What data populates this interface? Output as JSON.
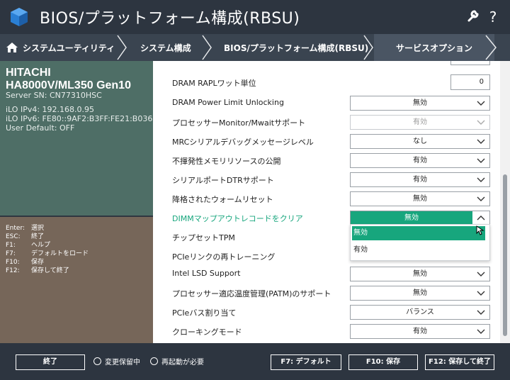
{
  "header": {
    "title": "BIOS/プラットフォーム構成(RBSU)",
    "icons": {
      "settings": "wrench-icon",
      "help": "?"
    }
  },
  "breadcrumb": [
    {
      "label": "システムユーティリティ"
    },
    {
      "label": "システム構成"
    },
    {
      "label": "BIOS/プラットフォーム構成(RBSU)"
    },
    {
      "label": "サービスオプション"
    }
  ],
  "server_info": {
    "vendor": "HITACHI",
    "model": "HA8000V/ML350 Gen10",
    "serial": "Server SN: CN77310HSC",
    "ipv4": "iLO IPv4: 192.168.0.95",
    "ipv6": "iLO IPv6: FE80::9AF2:B3FF:FE21:B036",
    "user_default": "User Default: OFF"
  },
  "keys": [
    {
      "key": "Enter:",
      "desc": "選択"
    },
    {
      "key": "ESC:",
      "desc": "終了"
    },
    {
      "key": "F1:",
      "desc": "ヘルプ"
    },
    {
      "key": "F7:",
      "desc": "デフォルトをロード"
    },
    {
      "key": "F10:",
      "desc": "保存"
    },
    {
      "key": "F12:",
      "desc": "保存して終了"
    }
  ],
  "settings": [
    {
      "label": "DRAM RAPLワット単位",
      "value": "0"
    },
    {
      "label": "DRAM Power Limit Unlocking",
      "value": "無効"
    },
    {
      "label": "プロセッサーMonitor/Mwaitサポート",
      "value": "有効"
    },
    {
      "label": "MRCシリアルデバッグメッセージレベル",
      "value": "なし"
    },
    {
      "label": "不揮発性メモリリソースの公開",
      "value": "有効"
    },
    {
      "label": "シリアルポートDTRサポート",
      "value": "有効"
    },
    {
      "label": "降格されたウォームリセット",
      "value": "無効"
    },
    {
      "label": "DIMMマップアウトレコードをクリア",
      "value": "無効"
    },
    {
      "label": "チップセットTPM",
      "value": ""
    },
    {
      "label": "PCIeリンクの再トレーニング",
      "value": ""
    },
    {
      "label": "Intel LSD Support",
      "value": "無効"
    },
    {
      "label": "プロセッサー適応温度管理(PATM)のサポート",
      "value": "無効"
    },
    {
      "label": "PCIeバス割り当て",
      "value": "バランス"
    },
    {
      "label": "クローキングモード",
      "value": "有効"
    }
  ],
  "dropdown_options": [
    "無効",
    "有効"
  ],
  "footer": {
    "exit": "終了",
    "pending": "変更保留中",
    "reboot": "再起動が必要",
    "f7": "F7: デフォルト",
    "f10": "F10: 保存",
    "f12": "F12: 保存して終了"
  },
  "colors": {
    "accent": "#17a67d",
    "header_bg": "#2d3540",
    "info_bg": "#4e6e66",
    "keys_bg": "#766659"
  }
}
